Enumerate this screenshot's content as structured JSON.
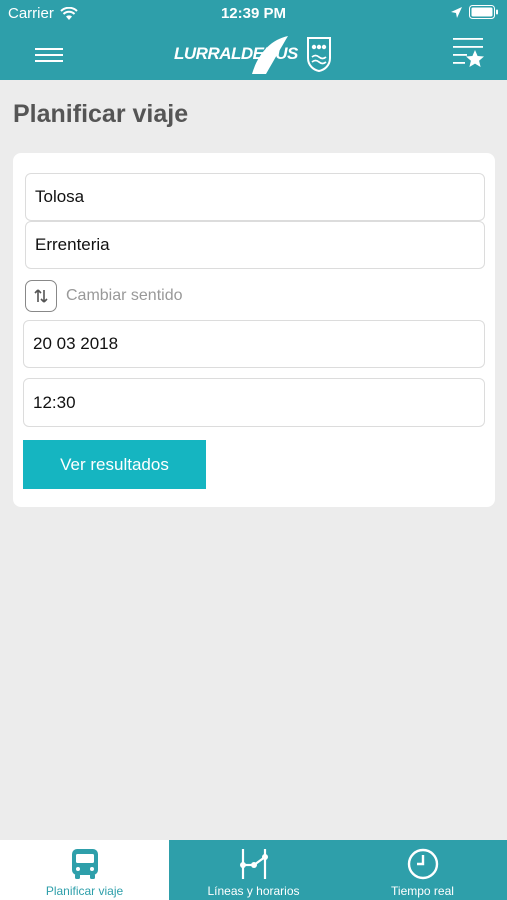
{
  "status_bar": {
    "carrier": "Carrier",
    "time": "12:39 PM"
  },
  "nav": {
    "logo_text": "LURRALDEBUS",
    "menu_icon": "hamburger-menu-icon",
    "favorites_icon": "favorites-list-icon"
  },
  "page": {
    "title": "Planificar viaje"
  },
  "form": {
    "origin": "Tolosa",
    "destination": "Errenteria",
    "swap_label": "Cambiar sentido",
    "date": "20 03 2018",
    "time": "12:30",
    "submit_label": "Ver resultados"
  },
  "tabs": [
    {
      "label": "Planificar viaje",
      "icon": "bus-icon",
      "active": true
    },
    {
      "label": "Líneas y horarios",
      "icon": "route-lines-icon",
      "active": false
    },
    {
      "label": "Tiempo real",
      "icon": "clock-icon",
      "active": false
    }
  ],
  "colors": {
    "brand": "#2e9faa",
    "button": "#15b5c1",
    "background": "#ececec"
  }
}
